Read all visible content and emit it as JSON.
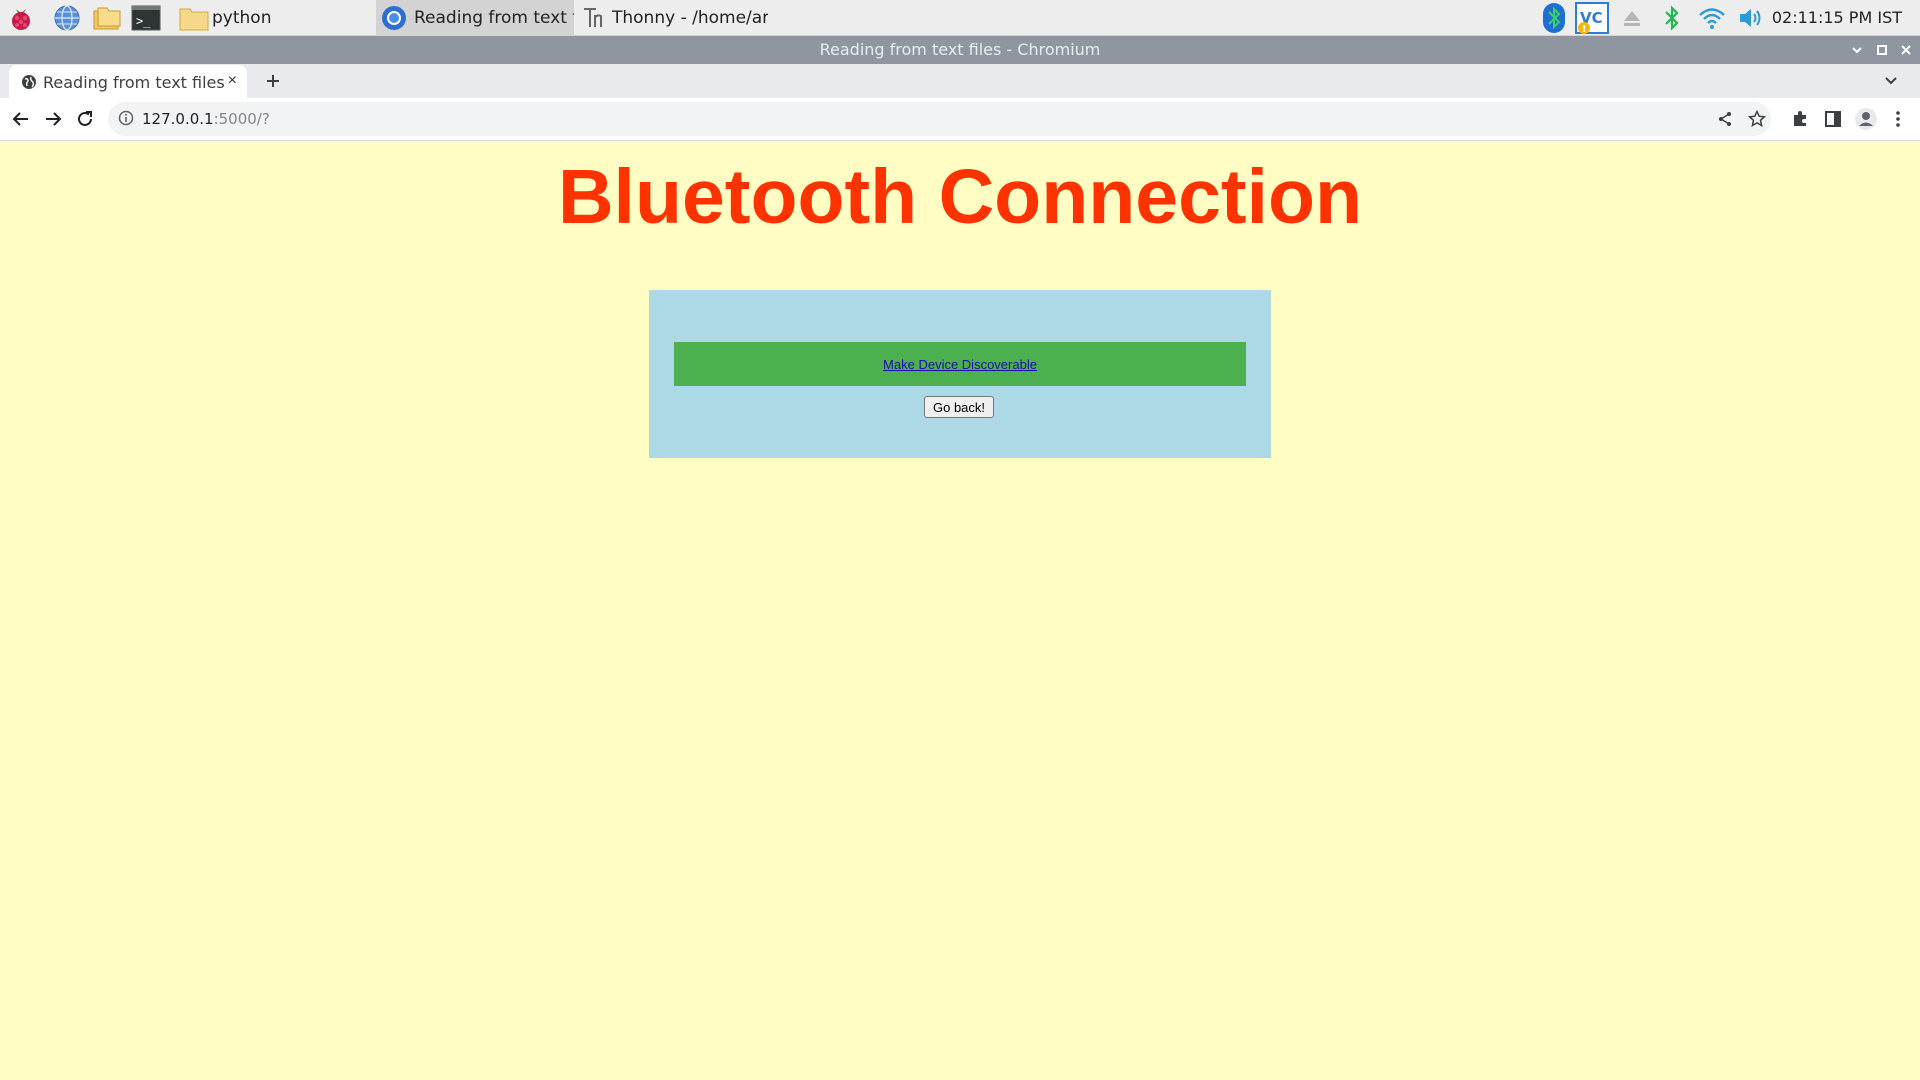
{
  "taskbar": {
    "launchers": [
      {
        "icon": "raspberry-menu-icon"
      },
      {
        "icon": "web-browser-icon"
      },
      {
        "icon": "file-manager-icon"
      },
      {
        "icon": "terminal-icon"
      }
    ],
    "tasks": [
      {
        "icon": "folder-icon",
        "label": "python"
      },
      {
        "icon": "chromium-icon",
        "label": "Reading from text file..."
      },
      {
        "icon": "thonny-icon",
        "label": "Thonny  -  /home/ar..."
      }
    ],
    "tray": {
      "vnc_label": "VC",
      "clock": "02:11:15 PM IST"
    }
  },
  "window": {
    "title": "Reading from text files - Chromium"
  },
  "browser": {
    "tab": {
      "title": "Reading from text files",
      "close": "×"
    },
    "newtab": "+",
    "url": {
      "host": "127.0.0.1",
      "path": ":5000/?"
    }
  },
  "page": {
    "heading": "Bluetooth Connection",
    "link_text": "Make Device Discoverable",
    "back_button": "Go back!",
    "colors": {
      "background": "#fffcc4",
      "heading": "#ff3200",
      "panel": "#add8e6",
      "bar": "#4caf50"
    }
  }
}
